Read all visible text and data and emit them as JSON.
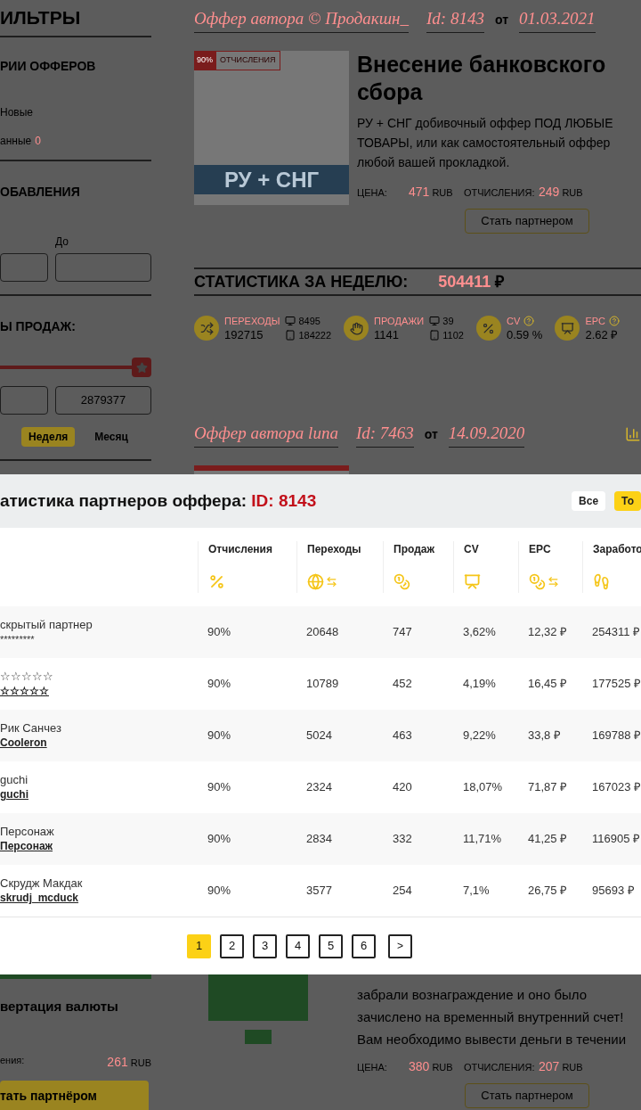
{
  "sidebar": {
    "title": "ИЛЬТРЫ",
    "categories": {
      "title": "РИИ ОФФЕРОВ",
      "items": [
        {
          "label": "Новые"
        },
        {
          "label": "анные",
          "count": "0"
        }
      ]
    },
    "date_added": {
      "title": "ОБАВЛЕНИЯ",
      "to_label": "До"
    },
    "sales": {
      "title": "Ы ПРОДАЖ:",
      "slider": {
        "level": 1
      },
      "max_value": "2879377",
      "periods": [
        {
          "label": "Неделя",
          "selected": true
        },
        {
          "label": "Месяц",
          "selected": false
        }
      ]
    }
  },
  "offer": {
    "author": "Оффер автора © Продакшн_",
    "id": "Id: 8143",
    "from": "от",
    "date": "01.03.2021",
    "badge_percent": "90%",
    "badge_label": "ОТЧИСЛЕНИЯ",
    "image_caption": "РУ + СНГ",
    "title": "Внесение банковского сбора",
    "description": "РУ + СНГ добивочный оффер ПОД ЛЮБЫЕ ТОВАРЫ, или как самостоятельный оффер любой вашей прокладкой.",
    "price_label": "ЦЕНА:",
    "price": "471",
    "price_currency": "RUB",
    "commission_label": "ОТЧИСЛЕНИЯ:",
    "commission": "249",
    "commission_currency": "RUB",
    "button": "Стать партнером"
  },
  "weekly_stats": {
    "title": "СТАТИСТИКА ЗА НЕДЕЛЮ:",
    "total": "504411",
    "currency": "₽",
    "items": [
      {
        "kind": "split",
        "label": "ПЕРЕХОДЫ",
        "value": "192715",
        "desktop": "8495",
        "mobile": "184222"
      },
      {
        "kind": "split",
        "label": "ПРОДАЖИ",
        "value": "1141",
        "desktop": "39",
        "mobile": "1102"
      },
      {
        "kind": "help",
        "label": "CV",
        "value": "0.59 %"
      },
      {
        "kind": "help",
        "label": "EPC",
        "value": "2.62 ₽"
      }
    ]
  },
  "next_offer": {
    "author": "Оффер автора luna",
    "id": "Id: 7463",
    "from": "от",
    "date": "14.09.2020"
  },
  "modal": {
    "title": "атистика партнеров оффера:",
    "offer_id": "ID: 8143",
    "filters": [
      {
        "label": "Все",
        "selected": false
      },
      {
        "label": "То",
        "selected": true
      }
    ],
    "columns": [
      "Отчисления",
      "Переходы",
      "Продаж",
      "CV",
      "EPC",
      "Заработо"
    ],
    "rows": [
      {
        "kind": "hidden",
        "name": "скрытый партнер",
        "login": "*********",
        "cells": [
          "90%",
          "20648",
          "747",
          "3,62%",
          "12,32 ₽",
          "254311 ₽"
        ]
      },
      {
        "kind": "user",
        "name": "☆☆☆☆☆",
        "login": "☆☆☆☆☆",
        "cells": [
          "90%",
          "10789",
          "452",
          "4,19%",
          "16,45 ₽",
          "177525 ₽"
        ]
      },
      {
        "kind": "user",
        "name": "Рик Санчез",
        "login": "Cooleron",
        "cells": [
          "90%",
          "5024",
          "463",
          "9,22%",
          "33,8 ₽",
          "169788 ₽"
        ]
      },
      {
        "kind": "user",
        "name": "guchi",
        "login": "guchi",
        "cells": [
          "90%",
          "2324",
          "420",
          "18,07%",
          "71,87 ₽",
          "167023 ₽"
        ]
      },
      {
        "kind": "user",
        "name": "Персонаж",
        "login": "Персонаж",
        "cells": [
          "90%",
          "2834",
          "332",
          "11,71%",
          "41,25 ₽",
          "116905 ₽"
        ]
      },
      {
        "kind": "user",
        "name": "Скрудж Макдак",
        "login": "skrudj_mcduck",
        "cells": [
          "90%",
          "3577",
          "254",
          "7,1%",
          "26,75 ₽",
          "95693 ₽"
        ]
      }
    ],
    "pages": [
      {
        "label": "1",
        "selected": true
      },
      {
        "label": "2",
        "selected": false
      },
      {
        "label": "3",
        "selected": false
      },
      {
        "label": "4",
        "selected": false
      },
      {
        "label": "5",
        "selected": false
      },
      {
        "label": "6",
        "selected": false
      }
    ],
    "next": ">"
  },
  "bottom": {
    "sidebar_offer": {
      "title": "вертация валюты",
      "label": "ения:",
      "value": "261",
      "currency": "RUB",
      "button": "тать партнёром"
    },
    "offer": {
      "description": "забрали вознаграждение и оно было зачислено на временный внутренний счет! Вам необходимо вывести деньги в течении",
      "price_label": "ЦЕНА:",
      "price": "380",
      "price_currency": "RUB",
      "commission_label": "ОТЧИСЛЕНИЯ:",
      "commission": "207",
      "commission_currency": "RUB",
      "button": "Стать партнером"
    }
  }
}
